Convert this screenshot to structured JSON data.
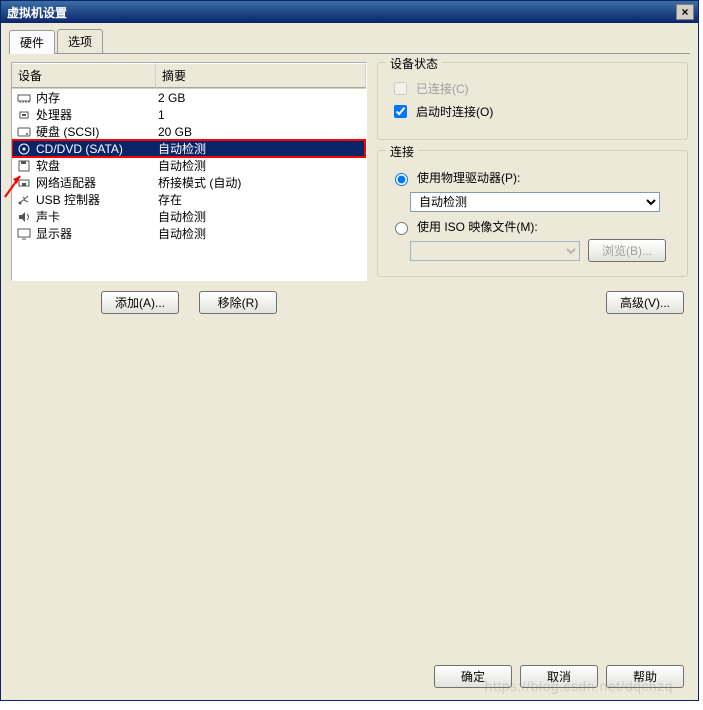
{
  "window": {
    "title": "虚拟机设置",
    "close": "×"
  },
  "tabs": {
    "hardware": "硬件",
    "options": "选项"
  },
  "columns": {
    "device": "设备",
    "summary": "摘要"
  },
  "devices": [
    {
      "icon": "memory-icon",
      "name": "内存",
      "summary": "2 GB"
    },
    {
      "icon": "cpu-icon",
      "name": "处理器",
      "summary": "1"
    },
    {
      "icon": "hdd-icon",
      "name": "硬盘 (SCSI)",
      "summary": "20 GB"
    },
    {
      "icon": "cd-icon",
      "name": "CD/DVD (SATA)",
      "summary": "自动检测"
    },
    {
      "icon": "floppy-icon",
      "name": "软盘",
      "summary": "自动检测"
    },
    {
      "icon": "nic-icon",
      "name": "网络适配器",
      "summary": "桥接模式 (自动)"
    },
    {
      "icon": "usb-icon",
      "name": "USB 控制器",
      "summary": "存在"
    },
    {
      "icon": "sound-icon",
      "name": "声卡",
      "summary": "自动检测"
    },
    {
      "icon": "display-icon",
      "name": "显示器",
      "summary": "自动检测"
    }
  ],
  "buttons": {
    "add": "添加(A)...",
    "remove": "移除(R)",
    "ok": "确定",
    "cancel": "取消",
    "help": "帮助",
    "advanced": "高级(V)...",
    "browse": "浏览(B)..."
  },
  "status_group": {
    "title": "设备状态",
    "connected": "已连接(C)",
    "connect_at_power": "启动时连接(O)"
  },
  "conn_group": {
    "title": "连接",
    "use_physical": "使用物理驱动器(P):",
    "use_iso": "使用 ISO 映像文件(M):",
    "drive_options": {
      "selected": "自动检测"
    }
  },
  "watermark": "https://blog.csdn.net/dqchzq"
}
